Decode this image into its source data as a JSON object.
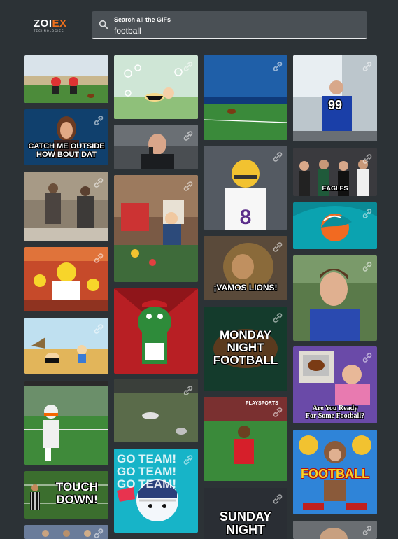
{
  "brand": {
    "name_left": "ZOI",
    "name_x": "EX",
    "tagline": "TECHNOLOGIES"
  },
  "search": {
    "label": "Search all the GIFs",
    "value": "football",
    "icon": "search-icon"
  },
  "link_icon": "link-icon",
  "captions": {
    "catch_me": "CATCH ME OUTSIDE\nHOW BOUT DAT",
    "eagles": "EAGLES",
    "vamos": "¡VAMOS LIONS!",
    "monday": "MONDAY\nNIGHT\nFOOTBALL",
    "ready": "Are You Ready\nFor Some Football?",
    "touchdown": "TOUCH\nDOWN!",
    "go_team": "GO TEAM! GO TEAM! GO TEAM!",
    "football": "FOOTBALL",
    "sunday": "SUNDAY\nNIGHT",
    "playsports": "PLAYSPORTS",
    "jersey": "99"
  }
}
